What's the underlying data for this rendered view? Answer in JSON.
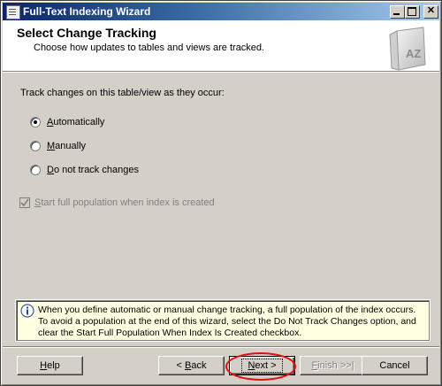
{
  "window": {
    "title": "Full-Text Indexing Wizard",
    "title_gradient_start": "#0a246a",
    "title_gradient_end": "#a6caf0",
    "controls": [
      "minimize-icon",
      "maximize-icon",
      "close-icon"
    ],
    "close_glyph": "✕"
  },
  "header": {
    "title": "Select Change Tracking",
    "subtitle": "Choose how updates to tables and views are tracked.",
    "icon": "book-az-icon",
    "icon_text": "AZ"
  },
  "body": {
    "prompt": "Track changes on this table/view as they occur:",
    "options": [
      {
        "mnemonic": "A",
        "rest": "utomatically",
        "label": "Automatically",
        "checked": true
      },
      {
        "mnemonic": "M",
        "rest": "anually",
        "label": "Manually",
        "checked": false
      },
      {
        "mnemonic": "D",
        "rest": "o not track changes",
        "label": "Do not track changes",
        "checked": false
      }
    ],
    "start_population": {
      "mnemonic": "S",
      "rest": "tart full population when index is created",
      "label": "Start full population when index is created",
      "checked": true,
      "enabled": false
    }
  },
  "info": {
    "icon": "info-icon",
    "text": "When you define automatic or manual change tracking, a full population of the index occurs. To avoid a population at the end of this wizard, select the Do Not Track Changes option, and clear the Start Full Population When Index Is Created checkbox."
  },
  "buttons": {
    "help": {
      "mnemonic": "H",
      "rest": "elp"
    },
    "back": {
      "prefix": "< ",
      "mnemonic": "B",
      "rest": "ack"
    },
    "next": {
      "mnemonic": "N",
      "rest": "ext >"
    },
    "finish": {
      "mnemonic": "F",
      "rest": "inish >>|",
      "enabled": false
    },
    "cancel": {
      "label": "Cancel"
    }
  },
  "colors": {
    "face": "#d4d0c8",
    "info_background": "#ffffe1",
    "highlight_ring": "#e01010"
  }
}
